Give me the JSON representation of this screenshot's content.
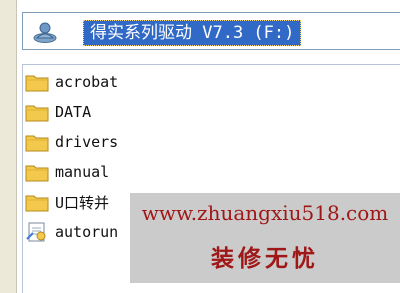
{
  "address_bar": {
    "icon": "cd-drive-user-icon",
    "value": "得实系列驱动 V7.3 (F:)"
  },
  "file_list": {
    "items": [
      {
        "name": "acrobat",
        "icon": "folder-icon"
      },
      {
        "name": "DATA",
        "icon": "folder-icon"
      },
      {
        "name": "drivers",
        "icon": "folder-icon"
      },
      {
        "name": "manual",
        "icon": "folder-icon"
      },
      {
        "name": "U口转并",
        "icon": "folder-icon"
      },
      {
        "name": "autorun",
        "icon": "setup-file-icon"
      }
    ]
  },
  "watermark": {
    "url": "www.zhuangxiu518.com",
    "name": "装修无忧",
    "color": "#a01717"
  },
  "colors": {
    "selection": "#3169c6",
    "folder": "#f2c94c"
  }
}
